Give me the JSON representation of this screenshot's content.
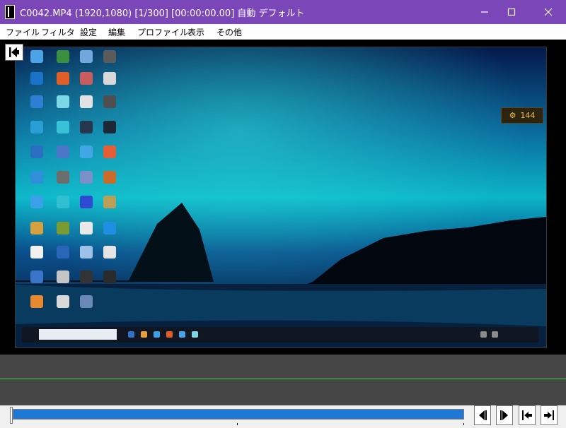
{
  "window": {
    "title": "C0042.MP4 (1920,1080)  [1/300] [00:00:00.00]  自動  デフォルト",
    "accent": "#7a46b8"
  },
  "menu": {
    "items": [
      "ファイル",
      "フィルタ",
      "設定",
      "編集",
      "プロファイル",
      "表示",
      "その他"
    ]
  },
  "viewer": {
    "badge_value": "144"
  },
  "controls": {
    "seek_fraction": 1.0
  },
  "colors": {
    "seek_fill": "#1e78d6",
    "timeline_line": "#47d14f"
  },
  "icons": {
    "app": "app-icon",
    "back": "jump-start-icon",
    "prev": "previous-frame-icon",
    "next": "next-frame-icon",
    "start": "go-to-start-icon",
    "end": "go-to-end-icon"
  }
}
